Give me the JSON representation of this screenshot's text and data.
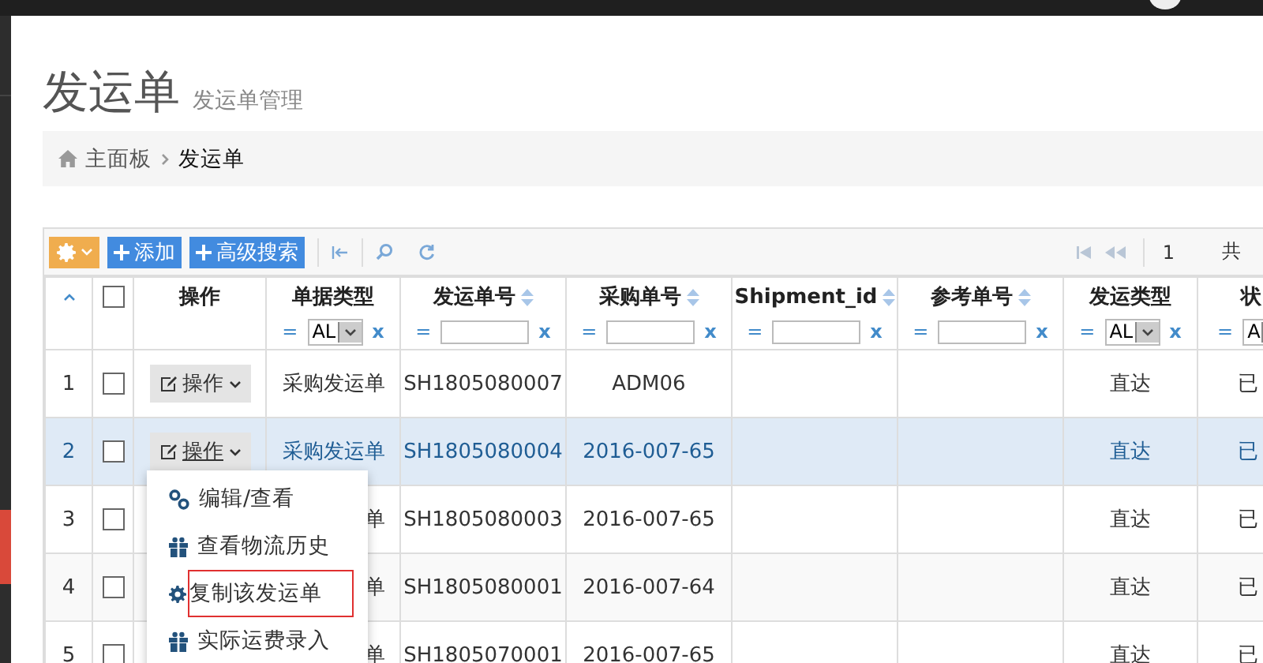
{
  "page_title": "发运单",
  "page_subtitle": "发运单管理",
  "breadcrumb": [
    {
      "label": "主面板",
      "kind": "home"
    },
    {
      "label": "发运单",
      "kind": "current"
    }
  ],
  "toolbar": {
    "buttons": [
      {
        "kind": "gear"
      },
      {
        "kind": "add",
        "label": "添加"
      },
      {
        "kind": "add",
        "label": "高级搜索"
      }
    ],
    "page": "1",
    "total_label": "共"
  },
  "table": {
    "all_checked": false,
    "columns": [
      {
        "label": "操作",
        "sortable": false
      },
      {
        "label": "单据类型",
        "sortable": false,
        "filter": {
          "kind": "select",
          "operator": "=",
          "value": "AL",
          "clear": "x"
        }
      },
      {
        "label": "发运单号",
        "sortable": true,
        "filter": {
          "kind": "text",
          "operator": "=",
          "clear": "x"
        }
      },
      {
        "label": "采购单号",
        "sortable": true,
        "filter": {
          "kind": "text",
          "operator": "=",
          "clear": "x"
        }
      },
      {
        "label": "Shipment_id",
        "sortable": true,
        "filter": {
          "kind": "text",
          "operator": "=",
          "clear": "x"
        }
      },
      {
        "label": "参考单号",
        "sortable": true,
        "filter": {
          "kind": "text",
          "operator": "=",
          "clear": "x"
        }
      },
      {
        "label": "发运类型",
        "sortable": false,
        "filter": {
          "kind": "select",
          "operator": "=",
          "value": "AL",
          "clear": "x"
        }
      },
      {
        "label": "状",
        "sortable": false,
        "filter": {
          "kind": "select",
          "operator": "=",
          "value": "A"
        }
      }
    ],
    "rows": [
      {
        "index": "1",
        "selected": false,
        "checked": false,
        "action": "操作",
        "doc_type": "采购发运单",
        "shipment_no": "SH1805080007",
        "po_no": "ADM06",
        "ship_type": "直达",
        "status": "已"
      },
      {
        "index": "2",
        "selected": true,
        "checked": false,
        "action": "操作",
        "doc_type": "采购发运单",
        "shipment_no": "SH1805080004",
        "po_no": "2016-007-65",
        "ship_type": "直达",
        "status": "已"
      },
      {
        "index": "3",
        "selected": false,
        "checked": false,
        "doc_type": "单",
        "shipment_no": "SH1805080003",
        "po_no": "2016-007-65",
        "ship_type": "直达",
        "status": "已"
      },
      {
        "index": "4",
        "selected": false,
        "checked": false,
        "doc_type": "单",
        "shipment_no": "SH1805080001",
        "po_no": "2016-007-64",
        "ship_type": "直达",
        "status": "已"
      },
      {
        "index": "5",
        "selected": false,
        "checked": false,
        "doc_type": "单",
        "shipment_no": "SH1805070001",
        "po_no": "2016-007-65",
        "ship_type": "直达",
        "status": "已"
      }
    ]
  },
  "action_menu": [
    {
      "label": "编辑/查看",
      "kind": "link",
      "highlighted": false
    },
    {
      "label": "查看物流历史",
      "kind": "gift",
      "highlighted": false
    },
    {
      "label": "复制该发运单",
      "kind": "gears",
      "highlighted": true
    },
    {
      "label": "实际运费录入",
      "kind": "gift",
      "highlighted": false
    }
  ]
}
